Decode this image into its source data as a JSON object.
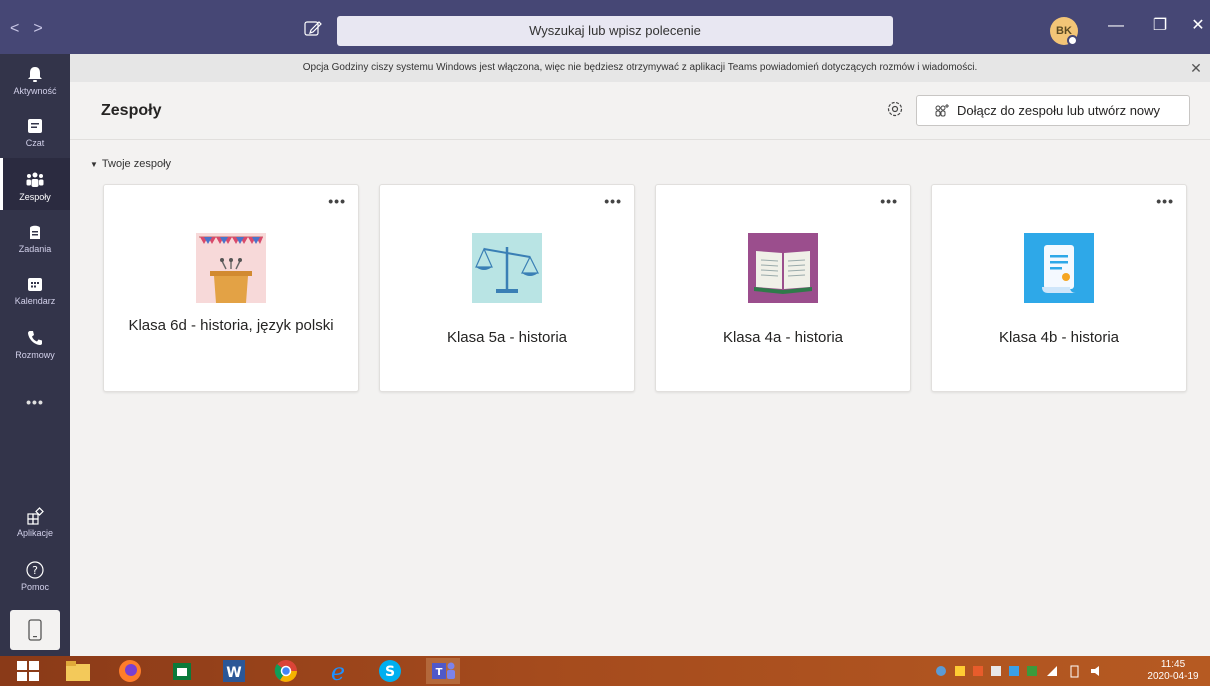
{
  "titlebar": {
    "search_text": "Wyszukaj lub wpisz polecenie",
    "avatar_initials": "BK",
    "nav_back_icon": "chevron-left-icon",
    "nav_forward_icon": "chevron-right-icon",
    "minimize": "—",
    "restore": "❐",
    "close": "✕"
  },
  "rail": {
    "items": [
      {
        "label": "Aktywność",
        "icon": "bell-icon"
      },
      {
        "label": "Czat",
        "icon": "chat-icon"
      },
      {
        "label": "Zespoły",
        "icon": "teams-icon"
      },
      {
        "label": "Zadania",
        "icon": "assignments-icon"
      },
      {
        "label": "Kalendarz",
        "icon": "calendar-icon"
      },
      {
        "label": "Rozmowy",
        "icon": "phone-icon"
      }
    ],
    "more": "•••",
    "apps_label": "Aplikacje",
    "help_label": "Pomoc"
  },
  "notification": {
    "text": "Opcja Godziny ciszy systemu Windows jest włączona, więc nie będziesz otrzymywać z aplikacji Teams powiadomień dotyczących rozmów i wiadomości.",
    "close": "✕"
  },
  "header": {
    "title": "Zespoły",
    "join_label": "Dołącz do zespołu lub utwórz nowy"
  },
  "section": {
    "label": "Twoje zespoły"
  },
  "teams": [
    {
      "name": "Klasa 6d - historia, język polski",
      "icon": "podium-icon",
      "more": "•••"
    },
    {
      "name": "Klasa 5a - historia",
      "icon": "scales-icon",
      "more": "•••"
    },
    {
      "name": "Klasa 4a - historia",
      "icon": "book-icon",
      "more": "•••"
    },
    {
      "name": "Klasa 4b - historia",
      "icon": "document-icon",
      "more": "•••"
    }
  ],
  "taskbar": {
    "time": "11:45",
    "date": "2020-04-19"
  },
  "colors": {
    "titlebar": "#464775",
    "rail": "#33344a",
    "accent": "#6264a7"
  }
}
